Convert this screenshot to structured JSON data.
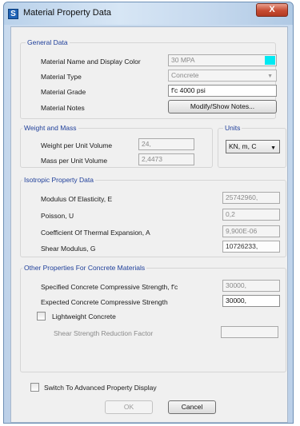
{
  "window": {
    "title": "Material Property Data",
    "close_glyph": "X",
    "app_icon_letter": "S"
  },
  "general": {
    "section_title": "General Data",
    "name_label": "Material Name and Display Color",
    "name_value": "30 MPA",
    "display_color": "#00e9f2",
    "type_label": "Material Type",
    "type_value": "Concrete",
    "grade_label": "Material Grade",
    "grade_value": "f'c 4000 psi",
    "notes_label": "Material Notes",
    "notes_button": "Modify/Show Notes..."
  },
  "weight": {
    "section_title": "Weight and Mass",
    "wpu_label": "Weight per Unit Volume",
    "wpu_value": "24,",
    "mpu_label": "Mass per Unit Volume",
    "mpu_value": "2,4473"
  },
  "units": {
    "section_title": "Units",
    "value": "KN, m, C"
  },
  "isotropic": {
    "section_title": "Isotropic Property Data",
    "e_label": "Modulus Of Elasticity,  E",
    "e_value": "25742960,",
    "u_label": "Poisson,  U",
    "u_value": "0,2",
    "a_label": "Coefficient Of Thermal Expansion,  A",
    "a_value": "9,900E-06",
    "g_label": "Shear Modulus,  G",
    "g_value": "10726233,"
  },
  "concrete": {
    "section_title": "Other Properties For Concrete Materials",
    "fc_label": "Specified Concrete Compressive Strength, f'c",
    "fc_value": "30000,",
    "exp_label": "Expected Concrete Compressive Strength",
    "exp_value": "30000,",
    "lightweight_label": "Lightweight Concrete",
    "shear_factor_label": "Shear Strength Reduction Factor",
    "shear_factor_value": ""
  },
  "footer": {
    "advanced_label": "Switch To Advanced Property Display",
    "ok_label": "OK",
    "cancel_label": "Cancel"
  }
}
